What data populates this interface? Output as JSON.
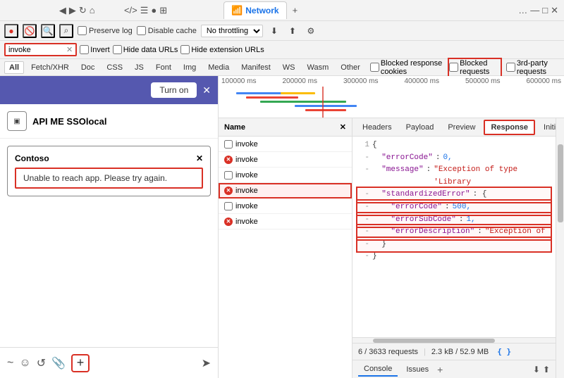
{
  "browser": {
    "tabs": {
      "network_label": "Network"
    },
    "icons": [
      "⬅",
      "➡",
      "↻",
      "🏠",
      "</>",
      "📦",
      "⚙",
      "🌐",
      "⬆",
      "⬇",
      "⚙",
      "…",
      "✕",
      "🗗"
    ]
  },
  "devtools": {
    "toolbar": {
      "record_label": "●",
      "clear_label": "🚫",
      "search_label": "🔍",
      "preserve_log": "Preserve log",
      "disable_cache": "Disable cache",
      "throttle": "No throttling",
      "download_icon": "⬇",
      "upload_icon": "⬆",
      "settings_icon": "⚙"
    },
    "filter": {
      "search_value": "invoke",
      "invert_label": "Invert",
      "hide_data_urls": "Hide data URLs",
      "hide_extension_urls": "Hide extension URLs"
    },
    "type_filters": [
      "All",
      "Fetch/XHR",
      "Doc",
      "CSS",
      "JS",
      "Font",
      "Img",
      "Media",
      "Manifest",
      "WS",
      "Wasm",
      "Other"
    ],
    "active_type": "All",
    "extra_filters": {
      "blocked_cookies": "Blocked response cookies",
      "blocked_requests": "Blocked requests",
      "third_party": "3rd-party requests"
    },
    "timeline_labels": [
      "100000 ms",
      "200000 ms",
      "300000 ms",
      "400000 ms",
      "500000 ms",
      "600000 ms"
    ],
    "name_column_header": "Name",
    "requests": [
      {
        "name": "invoke",
        "has_error": false,
        "selected": false
      },
      {
        "name": "invoke",
        "has_error": true,
        "selected": false
      },
      {
        "name": "invoke",
        "has_error": false,
        "selected": false
      },
      {
        "name": "invoke",
        "has_error": true,
        "selected": true,
        "highlighted": true
      },
      {
        "name": "invoke",
        "has_error": false,
        "selected": false
      },
      {
        "name": "invoke",
        "has_error": true,
        "selected": false
      }
    ],
    "detail_tabs": [
      "Headers",
      "Payload",
      "Preview",
      "Response",
      "Initiator"
    ],
    "active_detail_tab": "Response",
    "response": {
      "lines": [
        {
          "num": "1",
          "content": "{",
          "type": "punc"
        },
        {
          "num": "",
          "content": "\"errorCode\": 0,",
          "key": "errorCode",
          "val": "0",
          "type": "num"
        },
        {
          "num": "",
          "content": "\"message\": \"Exception of type 'Library",
          "key": "message",
          "val": "Exception of type 'Library",
          "type": "str"
        },
        {
          "num": "",
          "content": "\"standardizedError\": {",
          "key": "standardizedError",
          "highlighted": true
        },
        {
          "num": "",
          "content": "  \"errorCode\": 500,",
          "key": "errorCode",
          "val": "500",
          "type": "num",
          "indented": true,
          "highlighted": true
        },
        {
          "num": "",
          "content": "  \"errorSubCode\": 1,",
          "key": "errorSubCode",
          "val": "1",
          "type": "num",
          "indented": true,
          "highlighted": true
        },
        {
          "num": "",
          "content": "  \"errorDescription\": \"Exception of",
          "key": "errorDescription",
          "val": "Exception of",
          "type": "str",
          "indented": true,
          "highlighted": true
        },
        {
          "num": "",
          "content": "}",
          "type": "punc",
          "highlighted": true
        },
        {
          "num": "",
          "content": "}",
          "type": "punc"
        }
      ]
    },
    "status_bar": {
      "requests_count": "6 / 3633 requests",
      "data_size": "2.3 kB / 52.9 MB",
      "icon": "{ }"
    },
    "console_tabs": [
      "Console",
      "Issues"
    ],
    "bottom_icons": [
      "⬇",
      "⬆"
    ]
  },
  "app": {
    "header": {
      "turn_on_label": "Turn on",
      "close_label": "✕"
    },
    "api_me": {
      "icon": "▣",
      "title": "API ME SSOlocal"
    },
    "error_panel": {
      "header": "Contoso",
      "close_label": "✕",
      "message": "Unable to reach app. Please try again."
    },
    "bottom_toolbar": {
      "icons": [
        "~",
        "☺",
        "↺",
        "📎"
      ],
      "add_label": "+",
      "send_label": "➤"
    }
  }
}
